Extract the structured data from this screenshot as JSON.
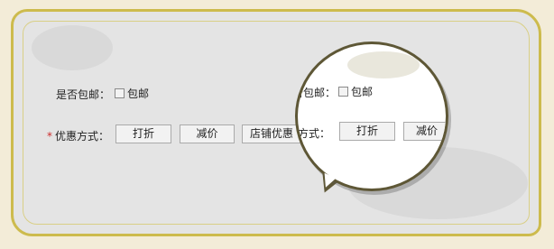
{
  "form": {
    "free_shipping_label": "是否包邮：",
    "free_shipping_option": "包邮",
    "free_shipping_checked": false,
    "required_mark": "*",
    "discount_method_label": "优惠方式：",
    "discount_buttons": [
      "打折",
      "减价",
      "店铺优惠"
    ]
  },
  "magnifier": {
    "free_shipping_label_partial": "否包邮：",
    "free_shipping_option": "包邮",
    "discount_method_label_partial": "惠方式：",
    "discount_buttons": [
      "打折",
      "减价"
    ]
  },
  "colors": {
    "background": "#f3ecd8",
    "panel": "#e4e4e4",
    "panel_border": "#cdbb4d",
    "required_star": "#cc2b2b",
    "magnifier_border": "#5e5736"
  }
}
